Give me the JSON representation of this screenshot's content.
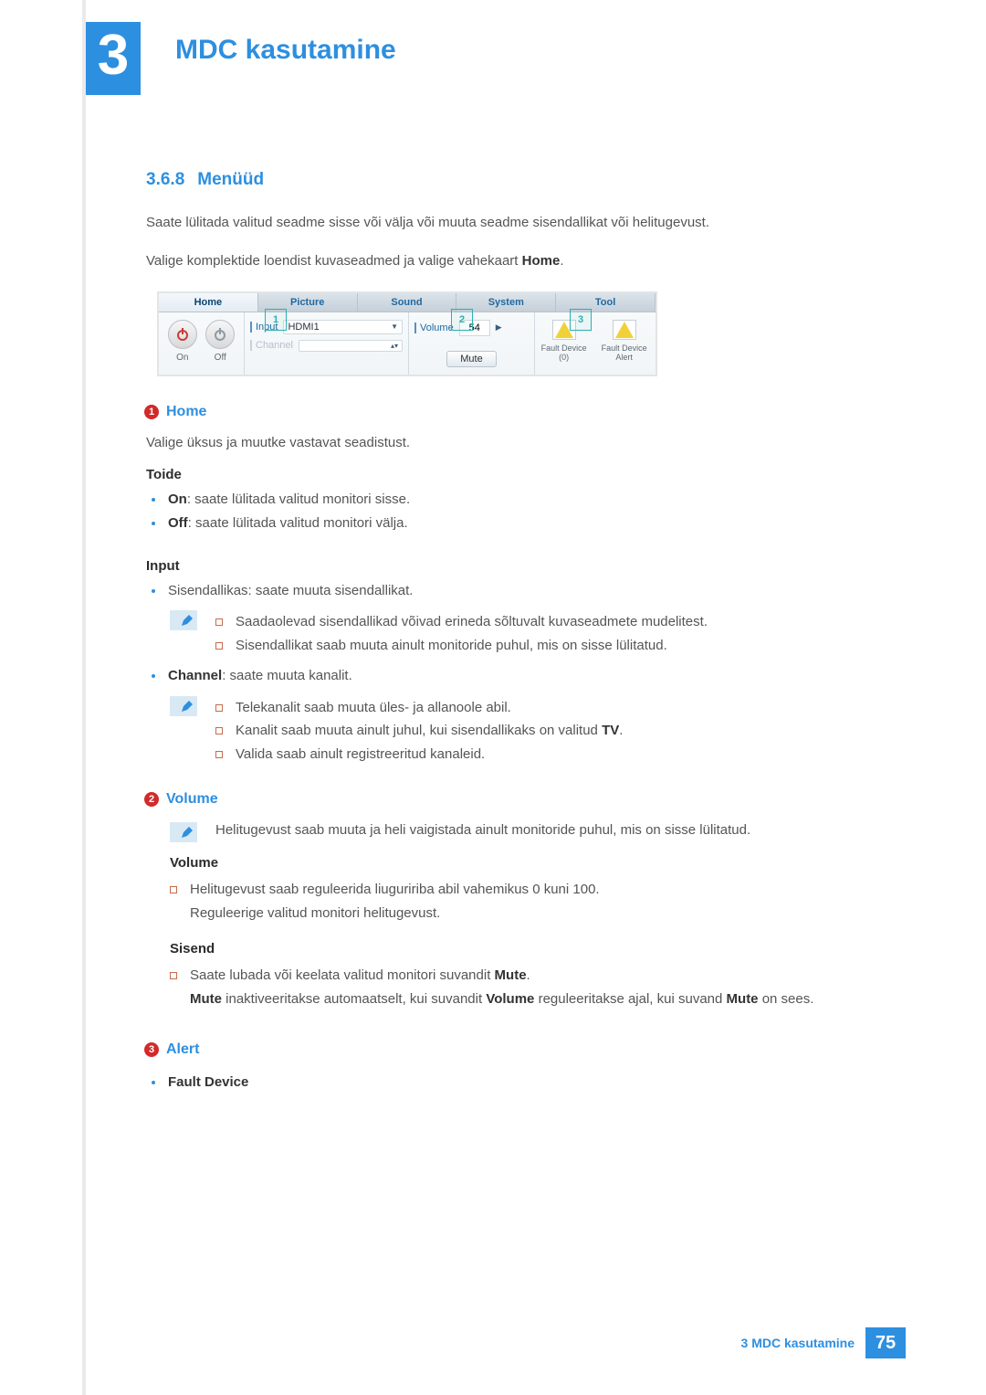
{
  "chapter": {
    "number": "3",
    "title": "MDC kasutamine"
  },
  "section": {
    "number": "3.6.8",
    "title": "Menüüd"
  },
  "intro1": "Saate lülitada valitud seadme sisse või välja või muuta seadme sisendallikat või helitugevust.",
  "intro2_a": "Valige komplektide loendist kuvaseadmed ja valige vahekaart ",
  "intro2_b": "Home",
  "intro2_c": ".",
  "ui": {
    "tabs": [
      "Home",
      "Picture",
      "Sound",
      "System",
      "Tool"
    ],
    "on": "On",
    "off": "Off",
    "input_lbl": "Input",
    "input_val": "HDMI1",
    "channel_lbl": "Channel",
    "volume_lbl": "Volume",
    "volume_val": "54",
    "mute": "Mute",
    "fault0": "Fault Device (0)",
    "fault_alert": "Fault Device Alert",
    "annot1": "1",
    "annot2": "2",
    "annot3": "3"
  },
  "s1": {
    "num": "1",
    "title": "Home",
    "intro": "Valige üksus ja muutke vastavat seadistust.",
    "toide_head": "Toide",
    "on_b": "On",
    "on_txt": ": saate lülitada valitud monitori sisse.",
    "off_b": "Off",
    "off_txt": ": saate lülitada valitud monitori välja.",
    "input_head": "Input",
    "input_li": "Sisendallikas: saate muuta sisendallikat.",
    "note_a": "Saadaolevad sisendallikad võivad erineda sõltuvalt kuvaseadmete mudelitest.",
    "note_b": "Sisendallikat saab muuta ainult monitoride puhul, mis on sisse lülitatud.",
    "channel_b": "Channel",
    "channel_txt": ": saate muuta kanalit.",
    "ch_a": "Telekanalit saab muuta üles- ja allanoole abil.",
    "ch_b_pre": "Kanalit saab muuta ainult juhul, kui sisendallikaks on valitud ",
    "ch_b_bold": "TV",
    "ch_b_post": ".",
    "ch_c": "Valida saab ainult registreeritud kanaleid."
  },
  "s2": {
    "num": "2",
    "title": "Volume",
    "note": "Helitugevust saab muuta ja heli vaigistada ainult monitoride puhul, mis on sisse lülitatud.",
    "vol_head": "Volume",
    "vol_a": "Helitugevust saab reguleerida liuguririba abil vahemikus 0 kuni 100.",
    "vol_b": "Reguleerige valitud monitori helitugevust.",
    "sisend_head": "Sisend",
    "sis_a_pre": "Saate lubada või keelata valitud monitori suvandit ",
    "sis_a_bold": "Mute",
    "sis_a_post": ".",
    "sis_b_1": "Mute",
    "sis_b_2": " inaktiveeritakse automaatselt, kui suvandit ",
    "sis_b_3": "Volume",
    "sis_b_4": " reguleeritakse ajal, kui suvand ",
    "sis_b_5": "Mute",
    "sis_b_6": " on sees."
  },
  "s3": {
    "num": "3",
    "title": "Alert",
    "fd": "Fault Device"
  },
  "footer": {
    "text": "3 MDC kasutamine",
    "page": "75"
  }
}
